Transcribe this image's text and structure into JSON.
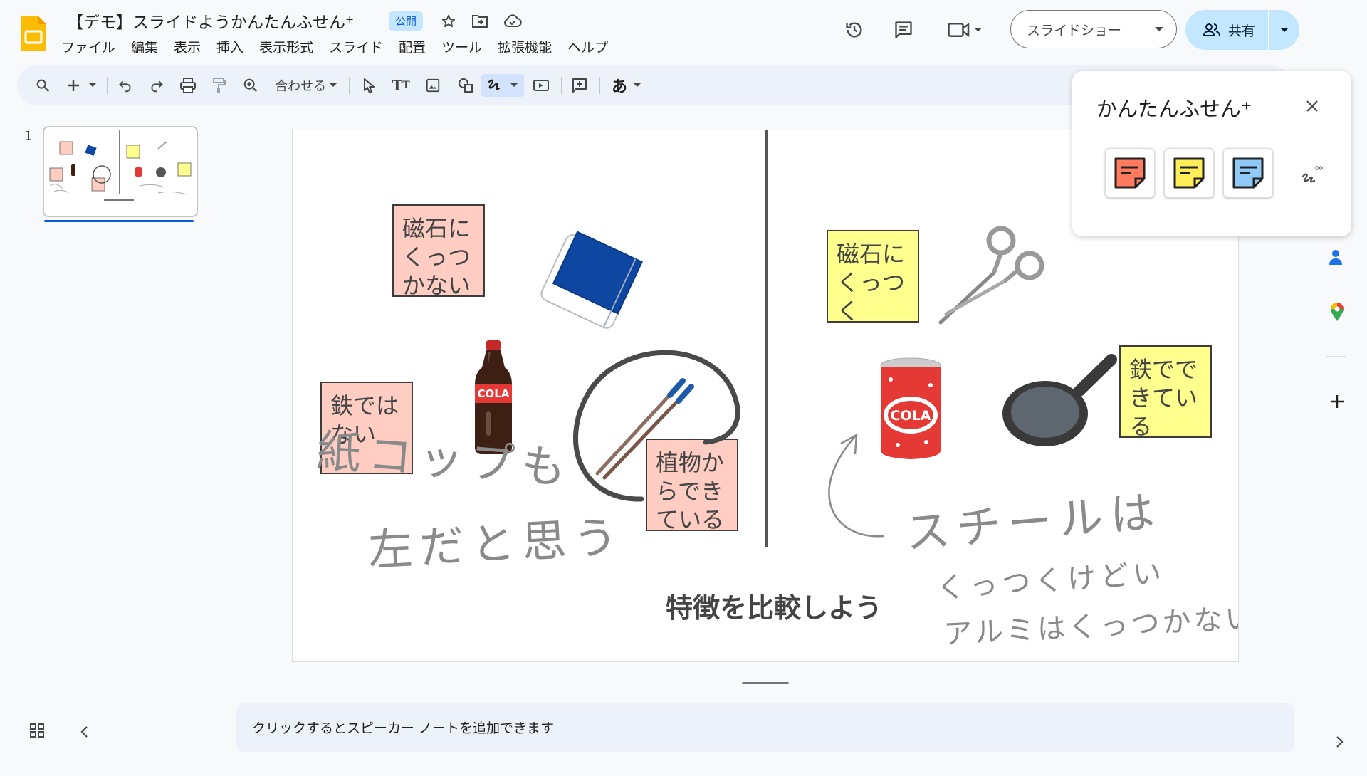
{
  "app": {
    "doc_title": "【デモ】スライドようかんたんふせん⁺",
    "badge": "公開",
    "menu": [
      "ファイル",
      "編集",
      "表示",
      "挿入",
      "表示形式",
      "スライド",
      "配置",
      "ツール",
      "拡張機能",
      "ヘルプ"
    ],
    "slideshow_label": "スライドショー",
    "share_label": "共有",
    "accent_color": "#0b57d0",
    "share_bg": "#c2e7ff"
  },
  "toolbar": {
    "zoom_label": "合わせる",
    "font_label": "あ",
    "icons": [
      "search-icon",
      "add-icon",
      "undo-icon",
      "redo-icon",
      "print-icon",
      "paint-format-icon",
      "zoom-icon",
      "select-icon",
      "text-box-icon",
      "image-icon",
      "shape-icon",
      "scribble-icon",
      "video-icon",
      "comment-add-icon"
    ]
  },
  "filmstrip": {
    "slide_number": "1"
  },
  "slide": {
    "notes": [
      {
        "text": "磁石にくっつかない",
        "color": "pink"
      },
      {
        "text": "鉄ではない",
        "color": "pink"
      },
      {
        "text": "植物からできている",
        "color": "pink"
      },
      {
        "text": "磁石にくっつく",
        "color": "yellow"
      },
      {
        "text": "鉄でできている",
        "color": "yellow"
      }
    ],
    "caption": "特徴を比較しよう",
    "handwriting": {
      "left_line1": "紙コップも",
      "left_line2": "左だと思う",
      "right_line1": "スチールは",
      "right_line2": "くっつくけどい",
      "right_line3": "アルミはくっつかない"
    },
    "cola_label": "COLA",
    "note_colors": {
      "pink": "#ffcdc2",
      "yellow": "#ffff8d",
      "blue": "#c2e7ff"
    }
  },
  "panel": {
    "title": "かんたんふせん⁺",
    "buttons": [
      "sticky-note-red-icon",
      "sticky-note-yellow-icon",
      "sticky-note-blue-icon"
    ]
  },
  "speaker_notes": {
    "placeholder": "クリックするとスピーカー ノートを追加できます"
  }
}
